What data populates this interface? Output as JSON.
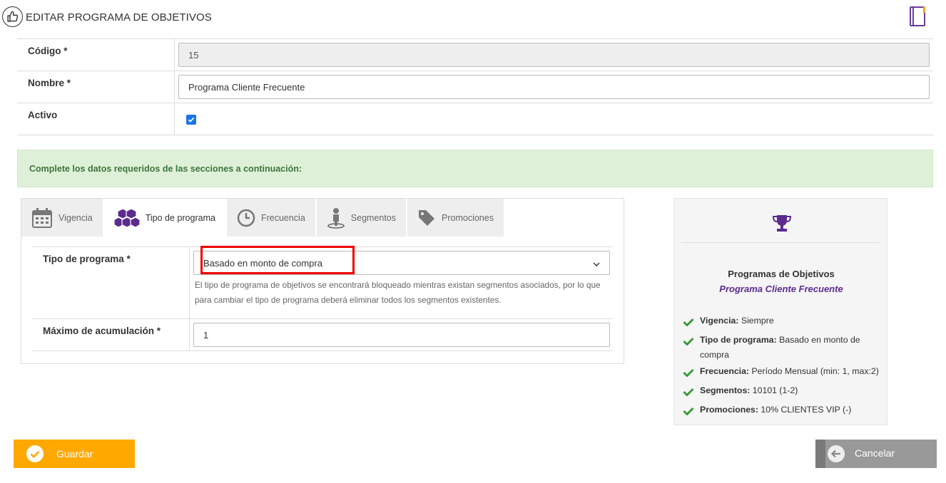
{
  "header": {
    "title": "EDITAR PROGRAMA DE OBJETIVOS",
    "logo_icon": "thumbs-up-icon",
    "help_icon": "book-icon"
  },
  "form": {
    "codigo_label": "Código *",
    "codigo_value": "15",
    "nombre_label": "Nombre *",
    "nombre_value": "Programa Cliente Frecuente",
    "activo_label": "Activo",
    "activo_checked": true
  },
  "alert": {
    "text": "Complete los datos requeridos de las secciones a continuación:"
  },
  "tabs": [
    {
      "label": "Vigencia",
      "icon": "calendar-icon",
      "active": false
    },
    {
      "label": "Tipo de programa",
      "icon": "cubes-icon",
      "active": true
    },
    {
      "label": "Frecuencia",
      "icon": "clock-icon",
      "active": false
    },
    {
      "label": "Segmentos",
      "icon": "person-pin-icon",
      "active": false
    },
    {
      "label": "Promociones",
      "icon": "tag-icon",
      "active": false
    }
  ],
  "tipo": {
    "label": "Tipo de programa *",
    "selected": "Basado en monto de compra",
    "help": "El tipo de programa de objetivos se encontrará bloqueado mientras existan segmentos asociados, por lo que para cambiar el tipo de programa deberá eliminar todos los segmentos existentes.",
    "max_label": "Máximo de acumulación *",
    "max_value": "1"
  },
  "summary": {
    "title": "Programas de Objetivos",
    "name": "Programa Cliente Frecuente",
    "items": [
      {
        "key": "Vigencia:",
        "value": " Siempre"
      },
      {
        "key": "Tipo de programa:",
        "value": " Basado en monto de compra"
      },
      {
        "key": "Frecuencia:",
        "value": " Período Mensual (min: 1, max:2)"
      },
      {
        "key": "Segmentos:",
        "value": " 10101 (1-2)"
      },
      {
        "key": "Promociones:",
        "value": " 10% CLIENTES VIP (-)"
      }
    ]
  },
  "buttons": {
    "save": "Guardar",
    "cancel": "Cancelar"
  },
  "colors": {
    "accent_purple": "#5b2c8e",
    "save_orange": "#ffa800",
    "check_green": "#3a9a3a",
    "alert_bg": "#dff0d8"
  }
}
